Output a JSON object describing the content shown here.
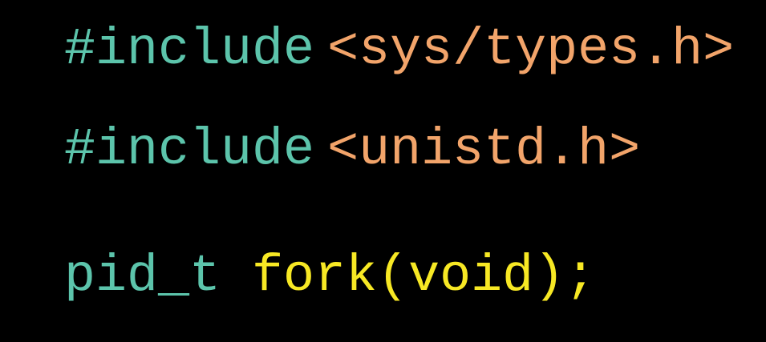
{
  "colors": {
    "keyword": "#5cc4ab",
    "header": "#f2a46a",
    "function": "#f7e824",
    "background": "#000000"
  },
  "code": [
    {
      "directive": "#include",
      "header": "<sys/types.h>"
    },
    {
      "directive": "#include",
      "header": "<unistd.h>"
    },
    {
      "type": "pid_t ",
      "signature": "fork(void);"
    }
  ]
}
